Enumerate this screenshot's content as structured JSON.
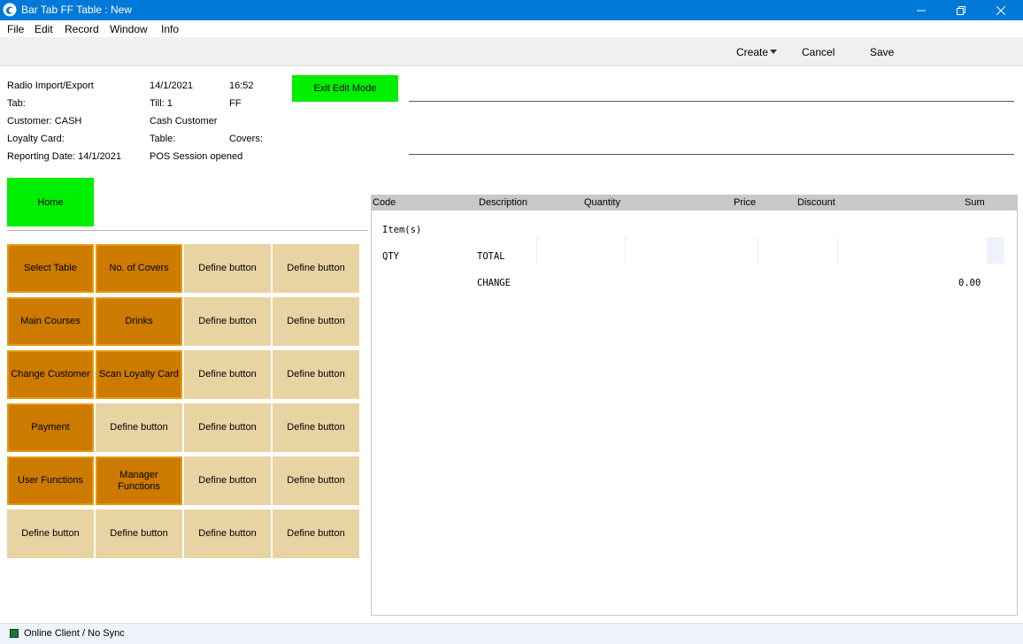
{
  "window": {
    "title": "Bar Tab FF Table : New"
  },
  "menu": [
    "File",
    "Edit",
    "Record",
    "Window",
    "Info"
  ],
  "toolbar": {
    "create": "Create",
    "cancel": "Cancel",
    "save": "Save"
  },
  "header": {
    "mode": "Radio Import/Export",
    "date": "14/1/2021",
    "time": "16:52",
    "tab": "Tab:",
    "till": "Till: 1",
    "till_code": "FF",
    "customer": "Customer: CASH",
    "customer_name": "Cash Customer",
    "loyalty": "Loyalty Card:",
    "table": "Table:",
    "covers": "Covers:",
    "reporting": "Reporting Date: 14/1/2021",
    "session": "POS Session opened",
    "exit_edit": "Exit Edit Mode"
  },
  "home": "Home",
  "buttons": [
    {
      "label": "Select Table",
      "active": true
    },
    {
      "label": "No. of  Covers",
      "active": true
    },
    {
      "label": "Define button",
      "active": false
    },
    {
      "label": "Define button",
      "active": false
    },
    {
      "label": "Main Courses",
      "active": true
    },
    {
      "label": "Drinks",
      "active": true
    },
    {
      "label": "Define button",
      "active": false
    },
    {
      "label": "Define button",
      "active": false
    },
    {
      "label": "Change Customer",
      "active": true
    },
    {
      "label": "Scan Loyalty Card",
      "active": true
    },
    {
      "label": "Define button",
      "active": false
    },
    {
      "label": "Define button",
      "active": false
    },
    {
      "label": "Payment",
      "active": true
    },
    {
      "label": "Define button",
      "active": false
    },
    {
      "label": "Define button",
      "active": false
    },
    {
      "label": "Define button",
      "active": false
    },
    {
      "label": "User Functions",
      "active": true
    },
    {
      "label": "Manager Functions",
      "active": true
    },
    {
      "label": "Define button",
      "active": false
    },
    {
      "label": "Define button",
      "active": false
    },
    {
      "label": "Define button",
      "active": false
    },
    {
      "label": "Define button",
      "active": false
    },
    {
      "label": "Define button",
      "active": false
    },
    {
      "label": "Define button",
      "active": false
    }
  ],
  "table": {
    "columns": [
      "Code",
      "Description",
      "Quantity",
      "Price",
      "Discount",
      "Sum"
    ],
    "items_label": "Item(s)",
    "qty": "QTY",
    "total": "TOTAL",
    "change": "CHANGE",
    "change_value": "0.00"
  },
  "status": {
    "text": "Online Client / No Sync"
  },
  "colors": {
    "active_button": "#cc7a00",
    "define_button": "#e8d3a2",
    "green_button": "#00ee00",
    "titlebar": "#0078d7"
  }
}
